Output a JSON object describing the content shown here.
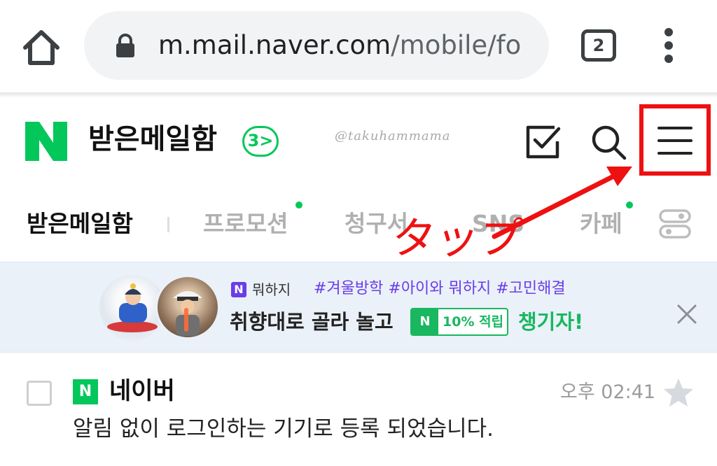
{
  "browser": {
    "url_host": "m.mail.naver.com",
    "url_path": "/mobile/fo",
    "tab_count": "2"
  },
  "header": {
    "logo_letter": "N",
    "title": "받은메일함",
    "unread_count": "3",
    "unread_chevron": ">",
    "watermark": "@takuhammama"
  },
  "folder_tabs": [
    {
      "label": "받은메일함",
      "active": true
    },
    {
      "label": "프로모션",
      "active": false,
      "new": true
    },
    {
      "label": "청구서",
      "active": false
    },
    {
      "label": "SNS",
      "active": false
    },
    {
      "label": "카페",
      "active": false,
      "new": true
    }
  ],
  "annotation": {
    "text": "タップ",
    "color": "#ee1111"
  },
  "banner": {
    "logo_letter": "N",
    "service": "뭐하지",
    "tags": "#겨울방학 #아이와 뭐하지 #고민해결",
    "main_text": "취향대로 골라 놀고",
    "chip_letter": "N",
    "chip_text": "10% 적립",
    "cta": "챙기자!",
    "close_label": "×"
  },
  "mails": [
    {
      "sender_logo": "N",
      "sender": "네이버",
      "time": "오후 02:41",
      "subject": "알림 없이 로그인하는 기기로 등록 되었습니다."
    }
  ],
  "colors": {
    "naver_green": "#03c75a",
    "annotation_red": "#ee1111",
    "banner_bg": "#eaf1f8",
    "banner_purple": "#6a3de8"
  },
  "icons": [
    "home-icon",
    "lock-icon",
    "tab-switcher-icon",
    "more-vert-icon",
    "write-icon",
    "search-icon",
    "hamburger-menu-icon",
    "toggle-settings-icon",
    "close-icon",
    "star-icon"
  ]
}
